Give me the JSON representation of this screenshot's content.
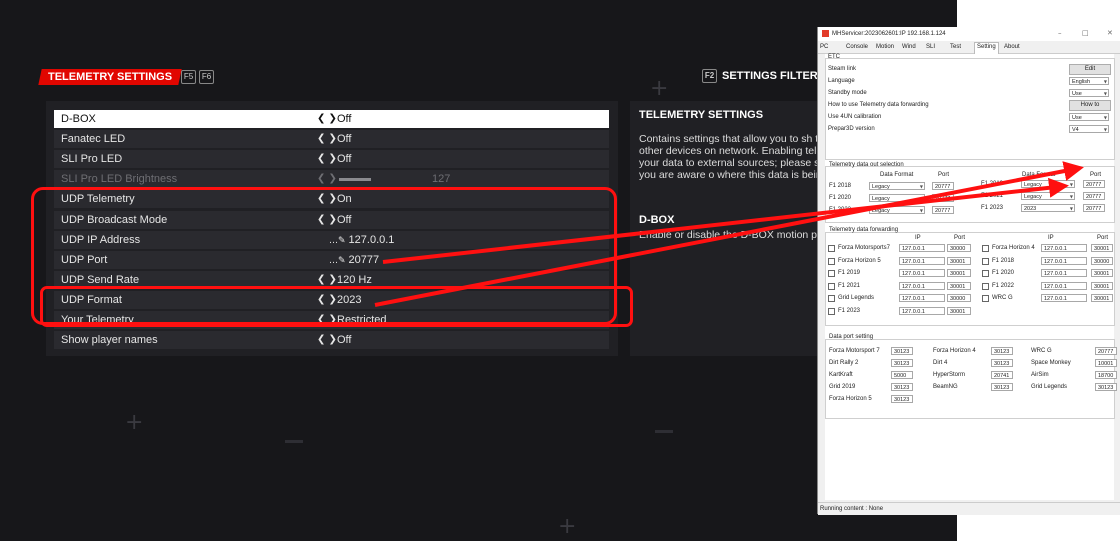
{
  "game": {
    "header_title": "TELEMETRY SETTINGS",
    "key_left_1": "F5",
    "key_left_2": "F6",
    "key_right": "F2",
    "filter_title": "SETTINGS FILTER",
    "rows": [
      {
        "label": "D-BOX",
        "value": "Off",
        "kind": "option",
        "state": "selected"
      },
      {
        "label": "Fanatec LED",
        "value": "Off",
        "kind": "option",
        "state": "normal"
      },
      {
        "label": "SLI Pro LED",
        "value": "Off",
        "kind": "option",
        "state": "normal"
      },
      {
        "label": "SLI Pro LED Brightness",
        "value": "127",
        "kind": "slider",
        "state": "disabled",
        "level": 0.8
      },
      {
        "label": "UDP Telemetry",
        "value": "On",
        "kind": "option",
        "state": "normal"
      },
      {
        "label": "UDP Broadcast Mode",
        "value": "Off",
        "kind": "option",
        "state": "normal"
      },
      {
        "label": "UDP IP Address",
        "value": "127.0.0.1",
        "kind": "edit",
        "state": "normal"
      },
      {
        "label": "UDP Port",
        "value": "20777",
        "kind": "edit",
        "state": "normal"
      },
      {
        "label": "UDP Send Rate",
        "value": "120 Hz",
        "kind": "option",
        "state": "normal"
      },
      {
        "label": "UDP Format",
        "value": "2023",
        "kind": "option",
        "state": "normal"
      },
      {
        "label": "Your Telemetry",
        "value": "Restricted",
        "kind": "option",
        "state": "occluded"
      },
      {
        "label": "Show player names",
        "value": "Off",
        "kind": "option",
        "state": "normal"
      }
    ],
    "info_title": "TELEMETRY SETTINGS",
    "info_text": "Contains settings that allow you to sh telemetry data with other devices on network. Enabling telemetry may tran your data to external sources; please steps to confirm that you are aware o where this data is being sent.",
    "info_title_2": "D-BOX",
    "info_text_2": "Enable or disable the D-BOX motion p"
  },
  "window": {
    "title": "MHServicer:2023062601:IP 192.168.1.124",
    "tabs": [
      "PC",
      "Console",
      "Motion",
      "Wind",
      "SLI",
      "Test",
      "Setting",
      "About"
    ],
    "active_tab": "Setting",
    "etc": {
      "label": "ETC",
      "rows": [
        {
          "label": "Steam link",
          "control": "button",
          "value": "Edit"
        },
        {
          "label": "Language",
          "control": "select",
          "value": "English"
        },
        {
          "label": "Standby mode",
          "control": "select",
          "value": "Use"
        },
        {
          "label": "How to use Telemetry data forwarding",
          "control": "button",
          "value": "How to"
        },
        {
          "label": "Use 4UN calibration",
          "control": "select",
          "value": "Use"
        },
        {
          "label": "Prepar3D version",
          "control": "select",
          "value": "V4"
        }
      ]
    },
    "selection": {
      "label": "Telemetry data out selection",
      "col_format": "Data Format",
      "col_port": "Port",
      "left": [
        {
          "game": "F1 2018",
          "format": "Legacy",
          "port": "20777"
        },
        {
          "game": "F1 2020",
          "format": "Legacy",
          "port": "20777"
        },
        {
          "game": "F1 2022",
          "format": "Legacy",
          "port": "20777"
        }
      ],
      "right": [
        {
          "game": "F1 2019",
          "format": "Legacy",
          "port": "20777"
        },
        {
          "game": "F1 2021",
          "format": "Legacy",
          "port": "20777"
        },
        {
          "game": "F1 2023",
          "format": "2023",
          "port": "20777"
        }
      ]
    },
    "forwarding": {
      "label": "Telemetry data forwarding",
      "col_ip": "IP",
      "col_port": "Port",
      "left": [
        {
          "game": "Forza Motorsports7",
          "ip": "127.0.0.1",
          "port": "30000"
        },
        {
          "game": "Forza Horizon 5",
          "ip": "127.0.0.1",
          "port": "30001"
        },
        {
          "game": "F1 2019",
          "ip": "127.0.0.1",
          "port": "30001"
        },
        {
          "game": "F1 2021",
          "ip": "127.0.0.1",
          "port": "30001"
        },
        {
          "game": "Grid Legends",
          "ip": "127.0.0.1",
          "port": "30000"
        },
        {
          "game": "F1 2023",
          "ip": "127.0.0.1",
          "port": "30001"
        }
      ],
      "right": [
        {
          "game": "Forza Horizon 4",
          "ip": "127.0.0.1",
          "port": "30001"
        },
        {
          "game": "F1 2018",
          "ip": "127.0.0.1",
          "port": "30000"
        },
        {
          "game": "F1 2020",
          "ip": "127.0.0.1",
          "port": "30001"
        },
        {
          "game": "F1 2022",
          "ip": "127.0.0.1",
          "port": "30001"
        },
        {
          "game": "WRC G",
          "ip": "127.0.0.1",
          "port": "30001"
        }
      ]
    },
    "ports": {
      "label": "Data port setting",
      "col1": [
        {
          "game": "Forza Motorsport 7",
          "port": "30123"
        },
        {
          "game": "Dirt Rally 2",
          "port": "30123"
        },
        {
          "game": "KartKraft",
          "port": "5000"
        },
        {
          "game": "Grid 2019",
          "port": "30123"
        },
        {
          "game": "Forza Horizon 5",
          "port": "30123"
        }
      ],
      "col2": [
        {
          "game": "Forza Horizon 4",
          "port": "30123"
        },
        {
          "game": "Dirt 4",
          "port": "30123"
        },
        {
          "game": "HyperStorm",
          "port": "20741"
        },
        {
          "game": "BeamNG",
          "port": "30123"
        }
      ],
      "col3": [
        {
          "game": "WRC G",
          "port": "20777"
        },
        {
          "game": "Space Monkey",
          "port": "10001"
        },
        {
          "game": "AirSim",
          "port": "18700"
        },
        {
          "game": "Grid Legends",
          "port": "30123"
        }
      ]
    },
    "status": "Running content : None"
  }
}
